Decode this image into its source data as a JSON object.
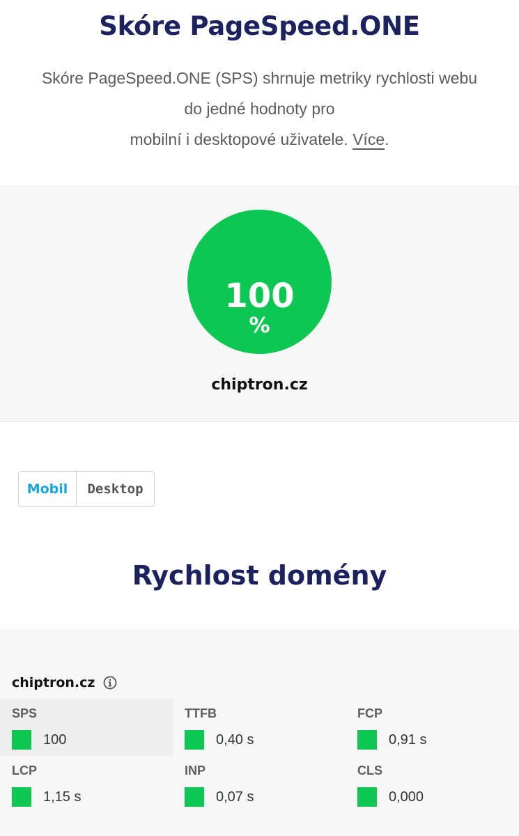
{
  "header": {
    "title": "Skóre PageSpeed.ONE",
    "intro_line1": "Skóre PageSpeed.ONE (SPS) shrnuje metriky rychlosti webu",
    "intro_line2": "do jedné hodnoty pro",
    "intro_line3": "mobilní i desktopové uživatele.",
    "more_link": "Více",
    "period": "."
  },
  "score": {
    "value": "100",
    "unit": "%",
    "domain": "chiptron.cz",
    "color": "#0cc752"
  },
  "tabs": [
    {
      "label": "Mobil",
      "active": true
    },
    {
      "label": "Desktop",
      "active": false
    }
  ],
  "section": {
    "title": "Rychlost domény"
  },
  "metrics": {
    "domain": "chiptron.cz",
    "info_icon": "info-icon",
    "items": [
      {
        "label": "SPS",
        "value": "100",
        "status_color": "#0cc752"
      },
      {
        "label": "TTFB",
        "value": "0,40 s",
        "status_color": "#0cc752"
      },
      {
        "label": "FCP",
        "value": "0,91 s",
        "status_color": "#0cc752"
      },
      {
        "label": "LCP",
        "value": "1,15 s",
        "status_color": "#0cc752"
      },
      {
        "label": "INP",
        "value": "0,07 s",
        "status_color": "#0cc752"
      },
      {
        "label": "CLS",
        "value": "0,000",
        "status_color": "#0cc752"
      }
    ]
  }
}
